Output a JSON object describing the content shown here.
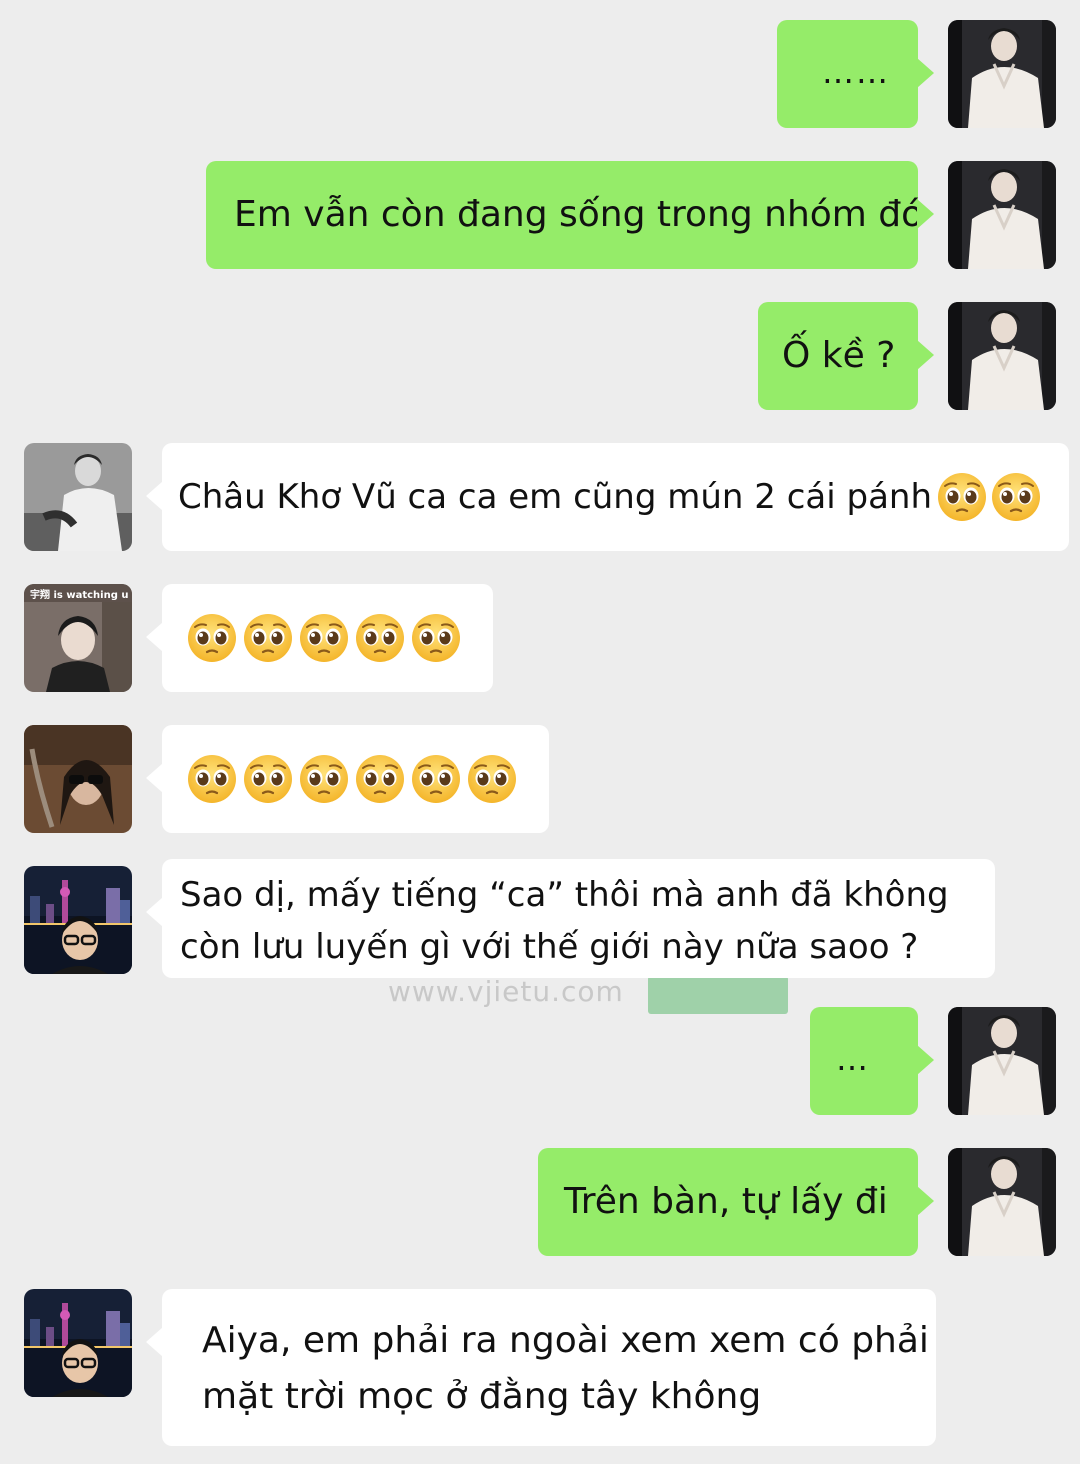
{
  "watermark": {
    "text": "www.vjietu.com"
  },
  "messages": [
    {
      "side": "out",
      "text": "……",
      "avatar_icon": "avatar-self"
    },
    {
      "side": "out",
      "text": "Em vẫn còn đang sống trong nhóm đó",
      "avatar_icon": "avatar-self"
    },
    {
      "side": "out",
      "text": "Ố kề ?",
      "avatar_icon": "avatar-self"
    },
    {
      "side": "in",
      "text": "Châu Khơ Vũ ca ca em cũng mún 2 cái pánh",
      "emoji_count": 2,
      "avatar_icon": "avatar-bw-man"
    },
    {
      "side": "in",
      "text": "",
      "emoji_count": 5,
      "avatar_icon": "avatar-watching",
      "avatar_caption": "宇翔 is watching u"
    },
    {
      "side": "in",
      "text": "",
      "emoji_count": 6,
      "avatar_icon": "avatar-sunglasses"
    },
    {
      "side": "in",
      "line1": "Sao dị, mấy tiếng “ca” thôi mà anh đã không",
      "line2": "còn lưu luyến gì với thế giới này nữa saoo ?",
      "avatar_icon": "avatar-city-night"
    },
    {
      "side": "out",
      "text": "…",
      "avatar_icon": "avatar-self"
    },
    {
      "side": "out",
      "text": "Trên bàn, tự lấy đi",
      "avatar_icon": "avatar-self"
    },
    {
      "side": "in",
      "line1": "Aiya, em phải ra ngoài xem xem có phải",
      "line2": "mặt trời mọc ở đằng tây không",
      "avatar_icon": "avatar-city-night"
    }
  ]
}
